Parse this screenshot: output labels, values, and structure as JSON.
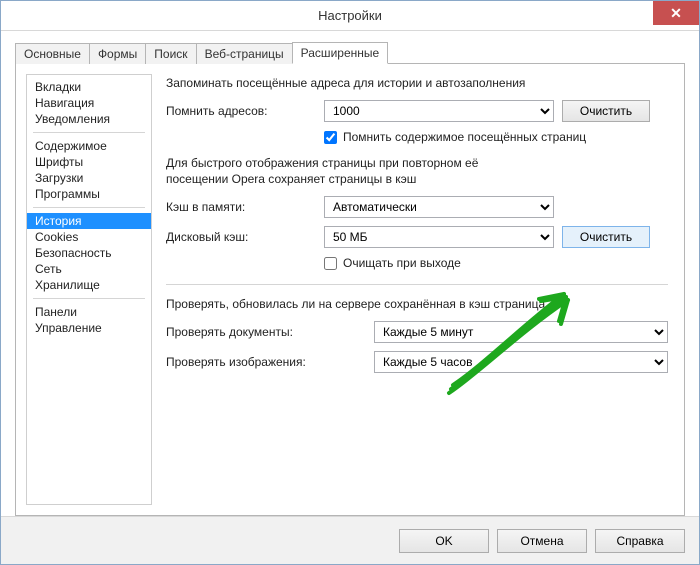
{
  "window": {
    "title": "Настройки",
    "close_glyph": "✕"
  },
  "tabs": [
    {
      "label": "Основные"
    },
    {
      "label": "Формы"
    },
    {
      "label": "Поиск"
    },
    {
      "label": "Веб-страницы"
    },
    {
      "label": "Расширенные",
      "active": true
    }
  ],
  "sidebar": {
    "items": [
      "Вкладки",
      "Навигация",
      "Уведомления",
      "Содержимое",
      "Шрифты",
      "Загрузки",
      "Программы",
      "История",
      "Cookies",
      "Безопасность",
      "Сеть",
      "Хранилище",
      "Панели",
      "Управление"
    ],
    "selected": "История"
  },
  "section_history": {
    "intro": "Запоминать посещённые адреса для истории и автозаполнения",
    "remember_addresses_label": "Помнить адресов:",
    "remember_addresses_value": "1000",
    "clear1_label": "Очистить",
    "remember_content_checked": true,
    "remember_content_label": "Помнить содержимое посещённых страниц",
    "cache_intro_a": "Для быстрого отображения страницы при повторном её",
    "cache_intro_b": "посещении Opera сохраняет страницы в кэш",
    "mem_cache_label": "Кэш в памяти:",
    "mem_cache_value": "Автоматически",
    "disk_cache_label": "Дисковый кэш:",
    "disk_cache_value": "50 МБ",
    "clear2_label": "Очистить",
    "clear_on_exit_checked": false,
    "clear_on_exit_label": "Очищать при выходе",
    "check_intro": "Проверять, обновилась ли на сервере сохранённая в кэш страница",
    "check_docs_label": "Проверять документы:",
    "check_docs_value": "Каждые 5 минут",
    "check_images_label": "Проверять изображения:",
    "check_images_value": "Каждые 5 часов"
  },
  "footer": {
    "ok": "OK",
    "cancel": "Отмена",
    "help": "Справка"
  },
  "colors": {
    "accent_green": "#1ea81e",
    "close_red": "#c75050",
    "select_blue": "#1e90ff"
  }
}
